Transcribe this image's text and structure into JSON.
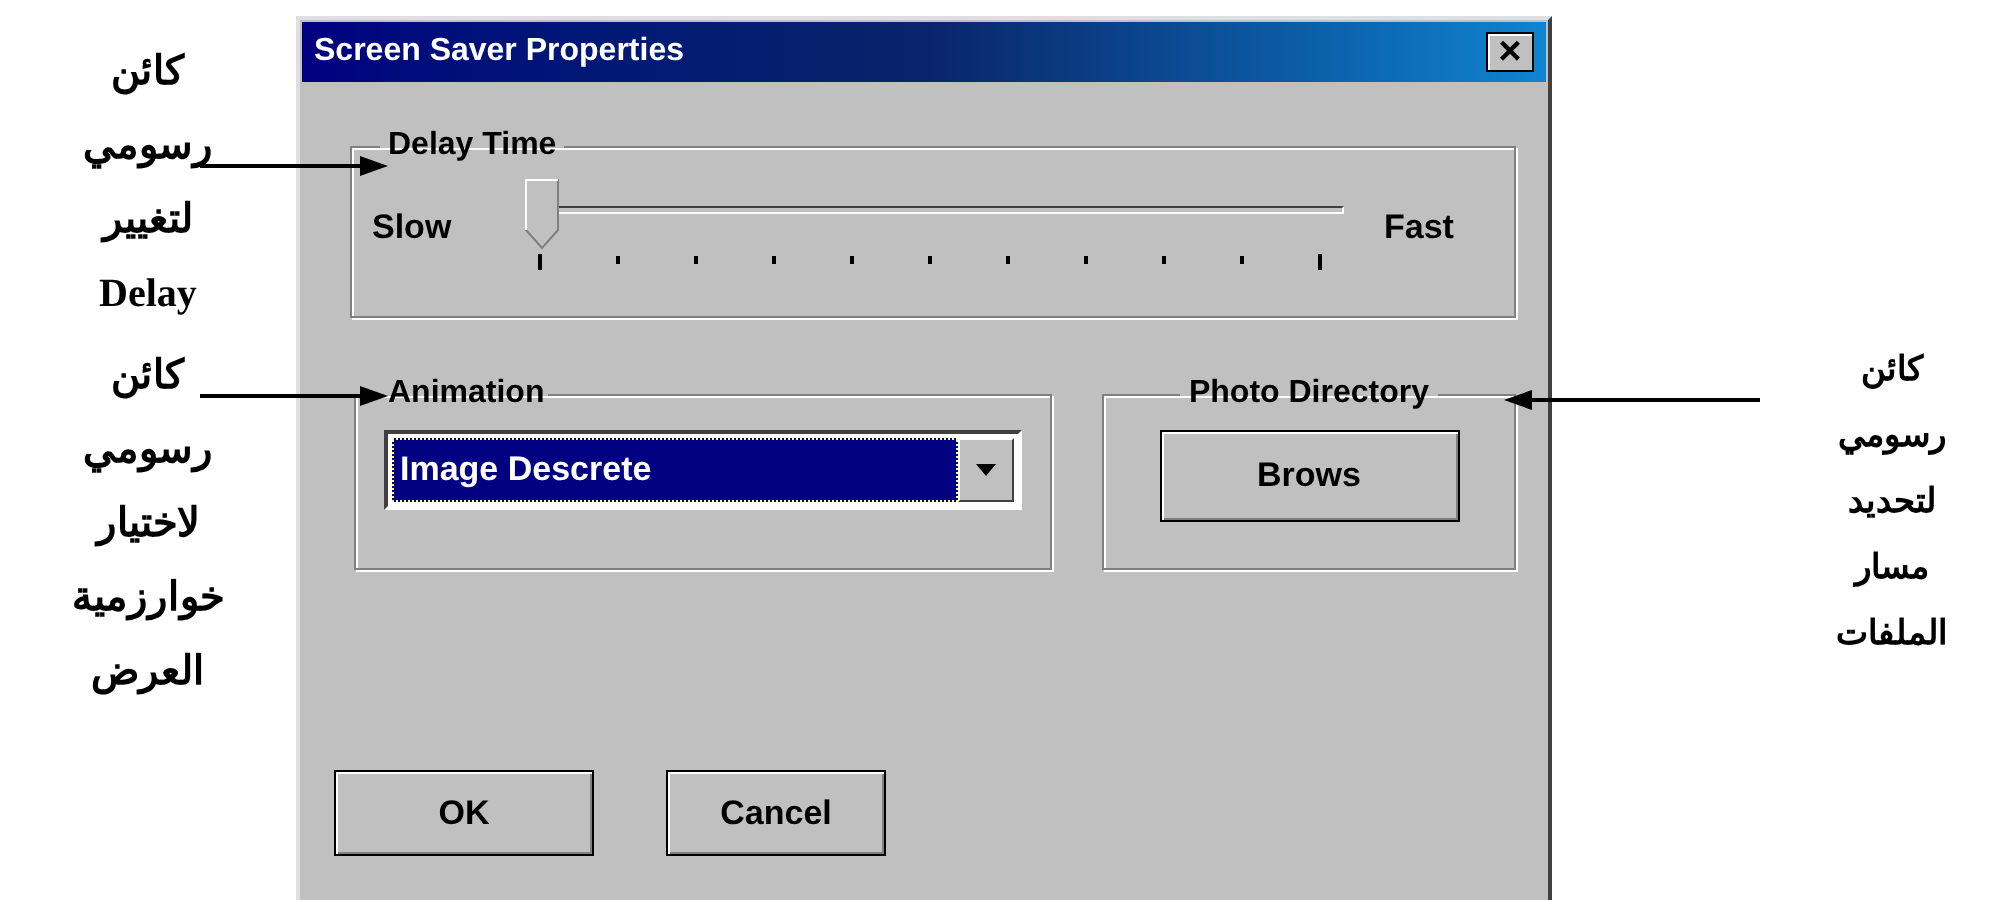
{
  "annotations_left": [
    {
      "lines": [
        "كائن",
        "رسومي",
        "لتغيير",
        "Delay"
      ]
    },
    {
      "lines": [
        "كائن",
        "رسومي",
        "لاختيار",
        "خوارزمية",
        "العرض"
      ]
    }
  ],
  "annotation_right": {
    "lines": [
      "كائن",
      "رسومي",
      "لتحديد",
      "مسار",
      "الملفات"
    ]
  },
  "dialog": {
    "title": "Screen Saver Properties",
    "close": "×",
    "delay": {
      "label": "Delay Time",
      "min_label": "Slow",
      "max_label": "Fast",
      "level": 0
    },
    "animation": {
      "label": "Animation",
      "value": "Image Descrete",
      "selected": true
    },
    "photo": {
      "label": "Photo Directory",
      "button": "Brows"
    },
    "ok_button": "OK",
    "cancel_button": "Cancel"
  }
}
